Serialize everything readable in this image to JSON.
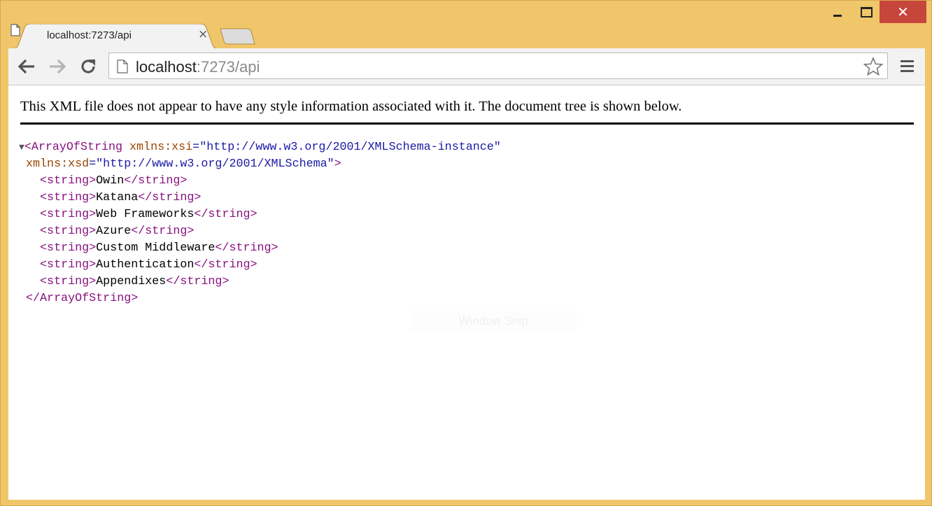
{
  "window": {
    "minimize_label": "",
    "close_label": "✕"
  },
  "tab": {
    "title": "localhost:7273/api",
    "close": "×"
  },
  "omnibox": {
    "host": "localhost",
    "rest": ":7273/api"
  },
  "content": {
    "notice": "This XML file does not appear to have any style information associated with it. The document tree is shown below.",
    "root_tag": "ArrayOfString",
    "xsi_attr": "xmlns:xsi",
    "xsi_value": "\"http://www.w3.org/2001/XMLSchema-instance\"",
    "xsd_attr": "xmlns:xsd",
    "xsd_value": "\"http://www.w3.org/2001/XMLSchema\"",
    "items": [
      "Owin",
      "Katana",
      "Web Frameworks",
      "Azure",
      "Custom Middleware",
      "Authentication",
      "Appendixes"
    ],
    "item_tag": "string",
    "toggle": "▼"
  },
  "overlay": {
    "window_snip": "Window Snip"
  }
}
